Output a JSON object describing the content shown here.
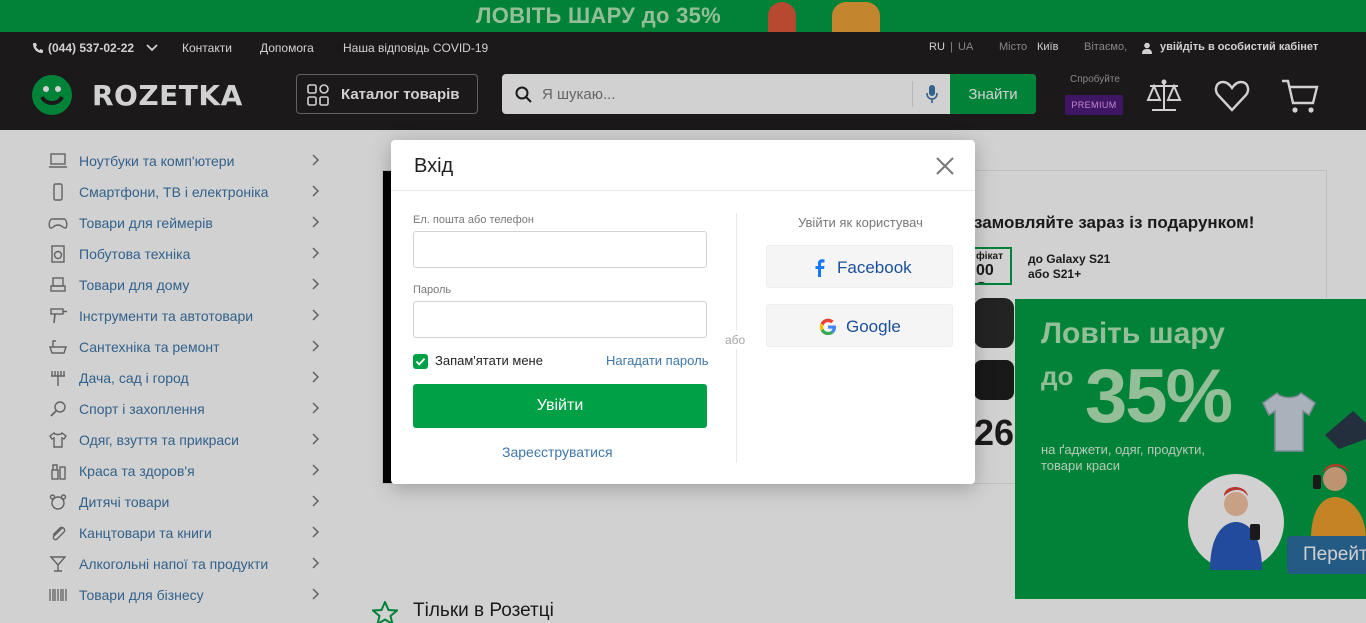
{
  "promo_banner": {
    "text": "ЛОВІТЬ ШАРУ до 35%"
  },
  "utility_bar": {
    "phone": "(044) 537-02-22",
    "links": [
      "Контакти",
      "Допомога",
      "Наша відповідь COVID-19"
    ],
    "lang_ru": "RU",
    "lang_sep": "|",
    "lang_ua": "UA",
    "city_label": "Місто",
    "city_value": "Київ",
    "greeting": "Вітаємо,",
    "login_link": "увійдіть в особистий кабінет"
  },
  "header": {
    "logo": "ROZETKA",
    "catalog_button": "Каталог товарів",
    "search_placeholder": "Я шукаю...",
    "search_button": "Знайти",
    "try_label": "Спробуйте",
    "premium_badge": "PREMIUM"
  },
  "sidebar": {
    "items": [
      {
        "label": "Ноутбуки та комп'ютери",
        "icon": "laptop-icon"
      },
      {
        "label": "Смартфони, ТВ і електроніка",
        "icon": "smartphone-icon"
      },
      {
        "label": "Товари для геймерів",
        "icon": "gamepad-icon"
      },
      {
        "label": "Побутова техніка",
        "icon": "washing-machine-icon"
      },
      {
        "label": "Товари для дому",
        "icon": "armchair-icon"
      },
      {
        "label": "Інструменти та автотовари",
        "icon": "drill-icon"
      },
      {
        "label": "Сантехніка та ремонт",
        "icon": "bathtub-icon"
      },
      {
        "label": "Дача, сад і город",
        "icon": "rake-icon"
      },
      {
        "label": "Спорт і захоплення",
        "icon": "racket-icon"
      },
      {
        "label": "Одяг, взуття та прикраси",
        "icon": "shirt-icon"
      },
      {
        "label": "Краса та здоров'я",
        "icon": "cosmetics-icon"
      },
      {
        "label": "Дитячі товари",
        "icon": "bear-icon"
      },
      {
        "label": "Канцтовари та книги",
        "icon": "paperclip-icon"
      },
      {
        "label": "Алкогольні напої та продукти",
        "icon": "cocktail-icon"
      },
      {
        "label": "Товари для бізнесу",
        "icon": "barcode-icon"
      }
    ]
  },
  "main_banner": {
    "title": "замовляйте зараз із подарунком!",
    "cert_line1": "фікат",
    "cert_line2": "00 ₴",
    "subtitle_line1": "до Galaxy S21",
    "subtitle_line2": "або S21+",
    "number": "26"
  },
  "only_rozetka": {
    "title": "Тільки в Розетці"
  },
  "promo_popup": {
    "title": "Ловіть шару",
    "prefix": "до",
    "percent": "35%",
    "description": "на ґаджети, одяг, продукти, товари краси",
    "button": "Перейт"
  },
  "login_modal": {
    "title": "Вхід",
    "email_label": "Ел. пошта або телефон",
    "email_value": "",
    "password_label": "Пароль",
    "password_value": "",
    "remember_label": "Запам'ятати мене",
    "remember_checked": true,
    "forgot_link": "Нагадати пароль",
    "login_button": "Увійти",
    "register_link": "Зареєструватися",
    "or_text": "або",
    "social_title": "Увійти як користувач",
    "facebook_button": "Facebook",
    "google_button": "Google"
  },
  "colors": {
    "brand_green": "#00a046",
    "header_dark": "#221f1f",
    "link_blue": "#3e77aa",
    "premium_purple": "#4d1b7b"
  }
}
